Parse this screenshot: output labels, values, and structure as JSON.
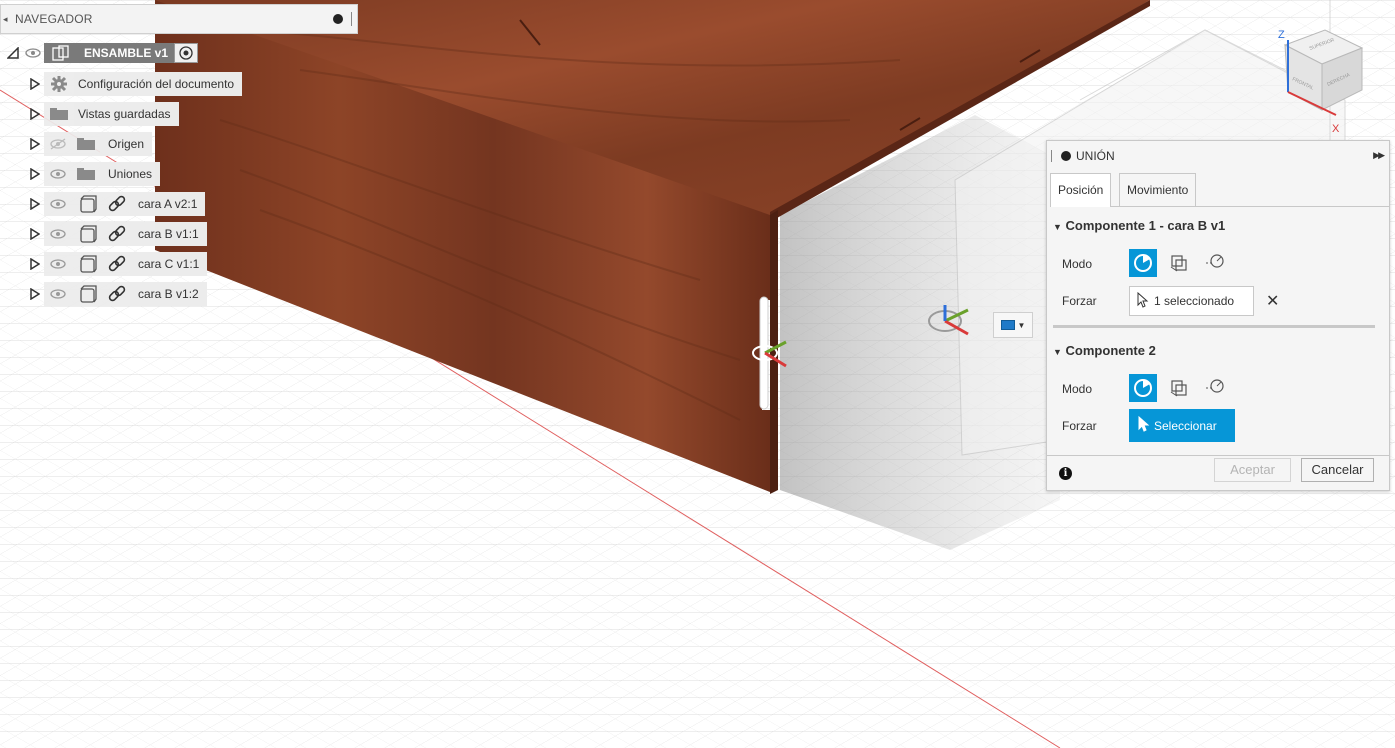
{
  "navigator": {
    "title": "NAVEGADOR",
    "root": {
      "label": "ENSAMBLE v1"
    },
    "items": [
      {
        "label": "Configuración del documento"
      },
      {
        "label": "Vistas guardadas"
      },
      {
        "label": "Origen"
      },
      {
        "label": "Uniones"
      },
      {
        "label": "cara A v2:1"
      },
      {
        "label": "cara B v1:1"
      },
      {
        "label": "cara C v1:1"
      },
      {
        "label": "cara B v1:2"
      }
    ]
  },
  "dialog": {
    "title": "UNIÓN",
    "tabs": [
      {
        "label": "Posición"
      },
      {
        "label": "Movimiento"
      }
    ],
    "component1": {
      "title": "Componente 1 - cara B v1",
      "mode_label": "Modo",
      "snap_label": "Forzar",
      "snap_value": "1 seleccionado"
    },
    "component2": {
      "title": "Componente 2",
      "mode_label": "Modo",
      "snap_label": "Forzar",
      "snap_value": "Seleccionar"
    },
    "ok_label": "Aceptar",
    "cancel_label": "Cancelar",
    "info_glyph": "i"
  },
  "viewcube": {
    "axis_z": "Z",
    "axis_x": "X",
    "face_top": "SUPERIOR",
    "face_front": "FRONTAL",
    "face_right": "DERECHA"
  },
  "colors": {
    "accent": "#0696d7",
    "wood_dark": "#5a2616",
    "wood_mid": "#8b4328",
    "wood_light": "#a4583a",
    "grid": "#dadada",
    "axis_red": "#e06060"
  }
}
